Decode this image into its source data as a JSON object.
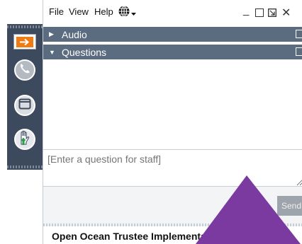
{
  "menubar": {
    "file": "File",
    "view": "View",
    "help": "Help",
    "language_icon": "globe-icon",
    "window_controls": [
      "minimize-icon",
      "maximize-icon",
      "restore-icon",
      "close-icon"
    ]
  },
  "sidebar": {
    "buttons": [
      {
        "name": "collapse-panel-button",
        "icon": "arrow-right-icon"
      },
      {
        "name": "audio-button",
        "icon": "phone-icon"
      },
      {
        "name": "screen-button",
        "icon": "window-icon"
      },
      {
        "name": "raise-hand-button",
        "icon": "hand-icon"
      }
    ]
  },
  "sections": {
    "audio": {
      "label": "Audio",
      "state": "collapsed"
    },
    "questions": {
      "label": "Questions",
      "state": "expanded"
    }
  },
  "question_box": {
    "placeholder": "[Enter a question for staff]",
    "send_label": "Send"
  },
  "footer": {
    "webinar_title": "Open Ocean Trustee Implementation Group..."
  },
  "colors": {
    "accent": "#f07b12",
    "toolbar": "#3d4a5e",
    "section_header": "#5b6b80",
    "pointer": "#7b3aa0"
  }
}
